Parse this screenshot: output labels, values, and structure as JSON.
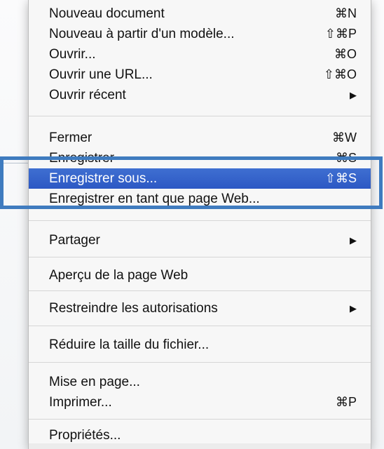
{
  "menu": {
    "items": [
      {
        "label": "Nouveau document",
        "shortcut": "⌘N"
      },
      {
        "label": "Nouveau à partir d'un modèle...",
        "shortcut": "⇧⌘P"
      },
      {
        "label": "Ouvrir...",
        "shortcut": "⌘O"
      },
      {
        "label": "Ouvrir une URL...",
        "shortcut": "⇧⌘O"
      },
      {
        "label": "Ouvrir récent",
        "submenu": "▶"
      },
      {
        "label": "Fermer",
        "shortcut": "⌘W"
      },
      {
        "label": "Enregistrer",
        "shortcut": "⌘S"
      },
      {
        "label": "Enregistrer sous...",
        "shortcut": "⇧⌘S"
      },
      {
        "label": "Enregistrer en tant que page Web..."
      },
      {
        "label": "Partager",
        "submenu": "▶"
      },
      {
        "label": "Aperçu de la page Web"
      },
      {
        "label": "Restreindre les autorisations",
        "submenu": "▶"
      },
      {
        "label": "Réduire la taille du fichier..."
      },
      {
        "label": "Mise en page..."
      },
      {
        "label": "Imprimer...",
        "shortcut": "⌘P"
      },
      {
        "label": "Propriétés..."
      }
    ]
  },
  "colors": {
    "selection": "#2f5fc9",
    "highlight_box": "#3f7bbf"
  }
}
